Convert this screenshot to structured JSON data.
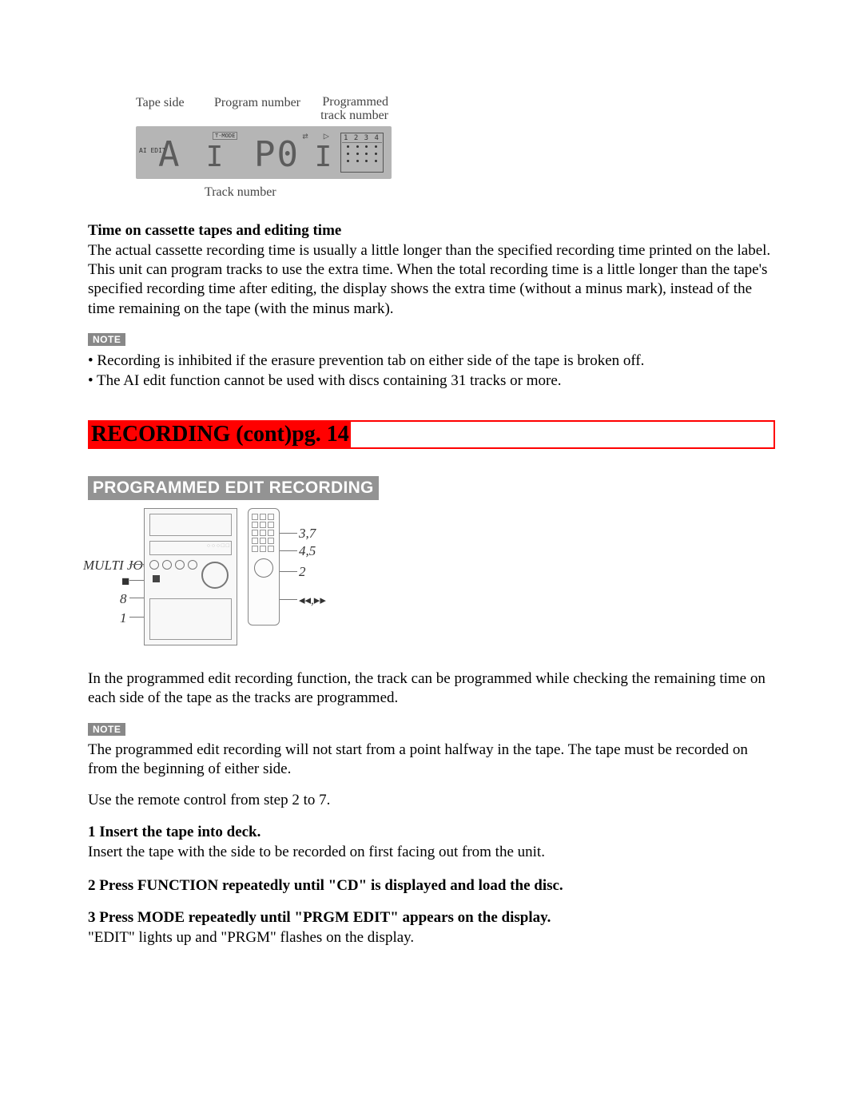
{
  "display_diagram": {
    "label_tape_side": "Tape side",
    "label_program_number": "Program number",
    "label_programmed_track": "Programmed\ntrack number",
    "label_track_number": "Track number",
    "lcd_left": "AI EDIT",
    "lcd_tmode": "T-MODE",
    "lcd_grid_header": "1 2 3 4"
  },
  "section1_title": "Time on cassette tapes and editing time",
  "section1_body": "The actual cassette recording time is usually a little longer than the specified recording time printed on the label. This unit can program tracks to use the extra time. When the total recording time is a little longer than the tape's specified recording time after editing, the display shows the extra time (without a minus mark), instead of the time remaining on the tape (with the minus mark).",
  "note_label": "NOTE",
  "note1_items": [
    "• Recording is inhibited if the erasure prevention tab on either side of the tape is broken off.",
    "• The AI edit function cannot be used with discs containing 31 tracks or more."
  ],
  "red_banner": "RECORDING (cont)pg. 14",
  "gray_banner": "PROGRAMMED EDIT RECORDING",
  "device_callouts": {
    "multi_jog": "MULTI JOG",
    "stop": "■",
    "eight": "8",
    "one": "1",
    "c37": "3,7",
    "c45": "4,5",
    "c2": "2",
    "cskip": "◂◂,▸▸"
  },
  "intro_para": "In the programmed edit recording function, the track can be programmed while checking the remaining time on each side of the tape as the tracks are programmed.",
  "note2_body": "The programmed edit recording will not start from a point halfway in the tape. The tape must be recorded on from the beginning of either side.",
  "remote_para": "Use the remote control from step 2 to 7.",
  "steps": [
    {
      "head": "1 Insert the tape into deck.",
      "body": "Insert the tape with the side to be recorded on first facing out from the unit."
    },
    {
      "head": "2 Press FUNCTION repeatedly until \"CD\" is displayed and load the disc.",
      "body": ""
    },
    {
      "head": "3 Press MODE repeatedly until \"PRGM EDIT\" appears on the display.",
      "body": "\"EDIT\" lights up and \"PRGM\" flashes on the display."
    }
  ]
}
